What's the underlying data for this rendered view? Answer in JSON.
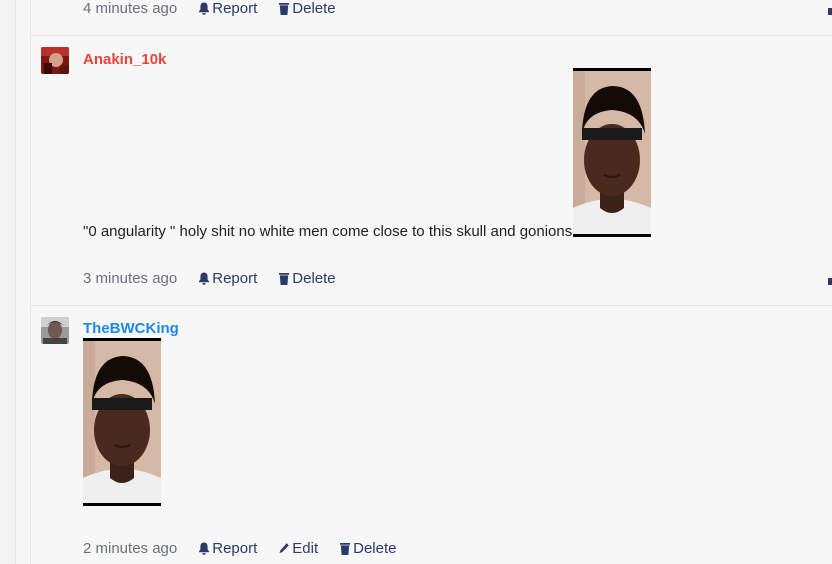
{
  "comments": [
    {
      "time": "4 minutes ago",
      "actions": {
        "report": "Report",
        "delete": "Delete"
      }
    },
    {
      "username": "Anakin_10k",
      "text": "\"0 angularity \" holy shit no white men come close to this skull and gonions",
      "time": "3 minutes ago",
      "actions": {
        "report": "Report",
        "delete": "Delete"
      }
    },
    {
      "username": "TheBWCKing",
      "time": "2 minutes ago",
      "actions": {
        "report": "Report",
        "edit": "Edit",
        "delete": "Delete"
      }
    }
  ],
  "icons": {
    "report": "bell-icon",
    "delete": "trash-icon",
    "edit": "pencil-icon"
  },
  "colors": {
    "action": "#2b3a67",
    "username_red": "#e8443a",
    "username_blue": "#1e88e5"
  }
}
